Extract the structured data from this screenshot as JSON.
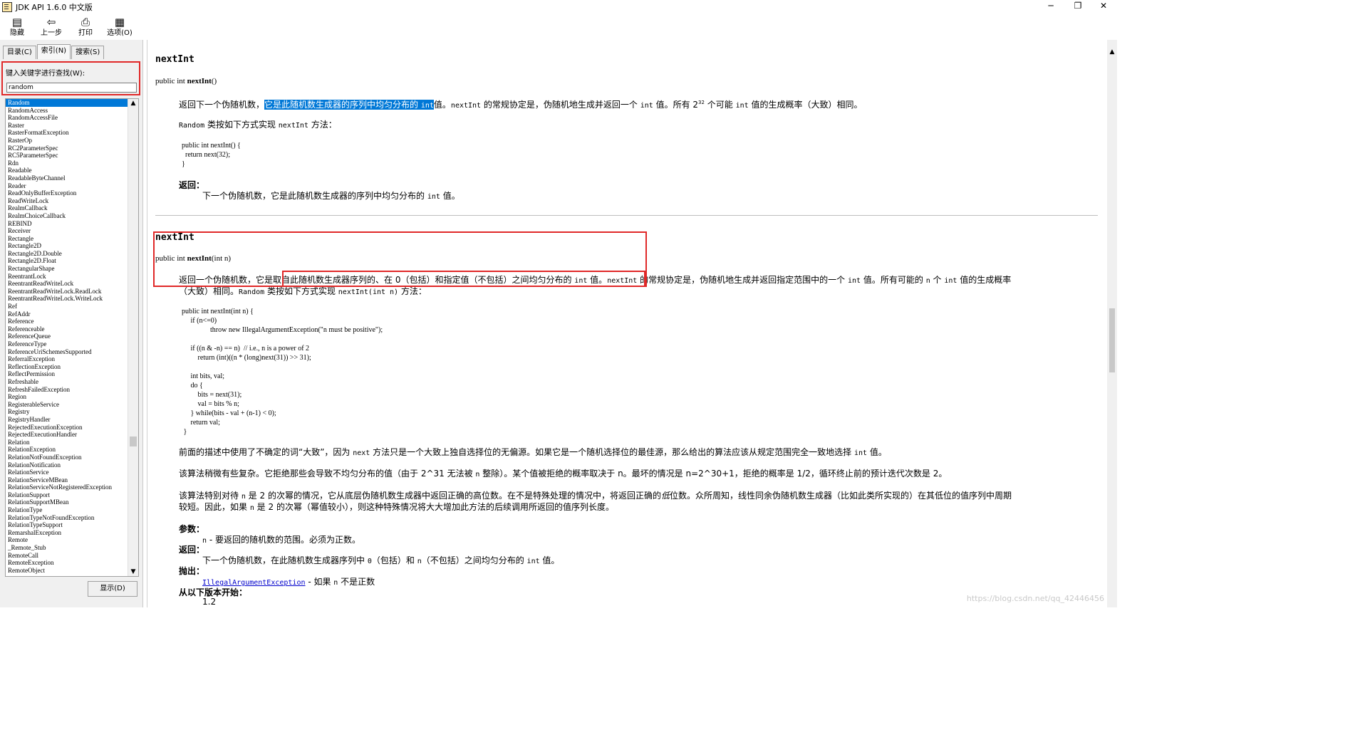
{
  "window": {
    "title": "JDK API 1.6.0 中文版",
    "controls": {
      "minimize": "─",
      "maximize": "❐",
      "close": "✕"
    }
  },
  "toolbar": {
    "hide": "隐藏",
    "back": "上一步",
    "print": "打印",
    "options": "选项(O)"
  },
  "left_pane": {
    "tabs": [
      "目录(C)",
      "索引(N)",
      "搜索(S)"
    ],
    "search_label": "键入关键字进行查找(W):",
    "search_value": "random",
    "items": [
      "Random",
      "RandomAccess",
      "RandomAccessFile",
      "Raster",
      "RasterFormatException",
      "RasterOp",
      "RC2ParameterSpec",
      "RC5ParameterSpec",
      "Rdn",
      "Readable",
      "ReadableByteChannel",
      "Reader",
      "ReadOnlyBufferException",
      "ReadWriteLock",
      "RealmCallback",
      "RealmChoiceCallback",
      "REBIND",
      "Receiver",
      "Rectangle",
      "Rectangle2D",
      "Rectangle2D.Double",
      "Rectangle2D.Float",
      "RectangularShape",
      "ReentrantLock",
      "ReentrantReadWriteLock",
      "ReentrantReadWriteLock.ReadLock",
      "ReentrantReadWriteLock.WriteLock",
      "Ref",
      "RefAddr",
      "Reference",
      "Referenceable",
      "ReferenceQueue",
      "ReferenceType",
      "ReferenceUriSchemesSupported",
      "ReferralException",
      "ReflectionException",
      "ReflectPermission",
      "Refreshable",
      "RefreshFailedException",
      "Region",
      "RegisterableService",
      "Registry",
      "RegistryHandler",
      "RejectedExecutionException",
      "RejectedExecutionHandler",
      "Relation",
      "RelationException",
      "RelationNotFoundException",
      "RelationNotification",
      "RelationService",
      "RelationServiceMBean",
      "RelationServiceNotRegisteredException",
      "RelationSupport",
      "RelationSupportMBean",
      "RelationType",
      "RelationTypeNotFoundException",
      "RelationTypeSupport",
      "RemarshalException",
      "Remote",
      "_Remote_Stub",
      "RemoteCall",
      "RemoteException",
      "RemoteObject"
    ],
    "selected": "Random",
    "display_button": "显示(D)"
  },
  "content": {
    "m1": {
      "name": "nextInt",
      "sig_pre": "public int ",
      "sig_name": "nextInt",
      "sig_post": "()",
      "p1_pre": "返回下一个伪随机数，",
      "p1_hl": "它是此随机数生成器的序列中均匀分布的 ",
      "p1_hl_code": "int",
      "p1_a": "值。",
      "p1_code1": "nextInt",
      "p1_b": " 的常规协定是，伪随机地生成并返回一个 ",
      "p1_code2": "int",
      "p1_c": " 值。所有 2",
      "p1_sup": "32",
      "p1_d": " 个可能 ",
      "p1_code3": "int",
      "p1_e": " 值的生成概率（大致）相同。",
      "p2_code1": "Random",
      "p2_a": " 类按如下方式实现 ",
      "p2_code2": "nextInt",
      "p2_b": " 方法：",
      "code": "public int nextInt() {\n  return next(32);\n}",
      "returns_label": "返回：",
      "returns_a": "下一个伪随机数，它是此随机数生成器的序列中均匀分布的 ",
      "returns_code": "int",
      "returns_b": " 值。"
    },
    "m2": {
      "name": "nextInt",
      "sig_pre": "public int ",
      "sig_name": "nextInt",
      "sig_post": "(int n)",
      "p1_a": "返回一个伪随机数，它是",
      "p1_box": "取自此随机数生成器序列的、在 0（包括）和指定值（不包括）之间均匀分布的 ",
      "p1_box_code": "int",
      "p1_box_b": " 值。",
      "p1_code1": "nextInt",
      "p1_b": " 的常规协定是，伪随机地生成并返回指定范围中的一个 ",
      "p1_code2": "int",
      "p1_c": " 值。所有可能的 ",
      "p1_code3": "n",
      "p1_d": " 个 ",
      "p1_code4": "int",
      "p1_e": " 值的生成概率",
      "p1_f": "（大致）相同。",
      "p1_code5": "Random",
      "p1_g": " 类按如下方式实现 ",
      "p1_code6": "nextInt(int n)",
      "p1_h": " 方法：",
      "code": "public int nextInt(int n) {\n     if (n<=0)\n                throw new IllegalArgumentException(\"n must be positive\");\n\n     if ((n & -n) == n)  // i.e., n is a power of 2\n         return (int)((n * (long)next(31)) >> 31);\n\n     int bits, val;\n     do {\n         bits = next(31);\n         val = bits % n;\n     } while(bits - val + (n-1) < 0);\n     return val;\n }",
      "p2_a": "前面的描述中使用了不确定的词“大致”，因为 ",
      "p2_code": "next",
      "p2_b": " 方法只是一个大致上独自选择位的无偏源。如果它是一个随机选择位的最佳源，那么给出的算法应该从规定范围完全一致地选择 ",
      "p2_code2": "int",
      "p2_c": " 值。",
      "p3_a": "该算法稍微有些复杂。它拒绝那些会导致不均匀分布的值（由于 2^31 无法被 ",
      "p3_code": "n",
      "p3_b": " 整除）。某个值被拒绝的概率取决于 n。最坏的情况是 n=2^30+1，拒绝的概率是 1/2，循环终止前的预计迭代次数是 2。",
      "p4_a": "该算法特别对待 ",
      "p4_code1": "n",
      "p4_b": " 是 2 的次幂的情况，它从底层伪随机数生成器中返回正确的高位数。在不是特殊处理的情况中，将返回正确的",
      "p4_italic": "低",
      "p4_c": "位数。众所周知，线性同余伪随机数生成器（比如此类所实现的）在其低位的值序列中周期",
      "p4_d": "较短。因此，如果 ",
      "p4_code2": "n",
      "p4_e": " 是 2 的次幂（幂值较小），则这种特殊情况将大大增加此方法的后续调用所返回的值序列长度。",
      "params_label": "参数：",
      "params_code": "n",
      "params_text": " - 要返回的随机数的范围。必须为正数。",
      "returns_label": "返回：",
      "returns_a": "下一个伪随机数，在此随机数生成器序列中 ",
      "returns_code1": "0",
      "returns_b": "（包括）和 ",
      "returns_code2": "n",
      "returns_c": "（不包括）之间均匀分布的 ",
      "returns_code3": "int",
      "returns_d": " 值。",
      "throws_label": "抛出：",
      "throws_link": "IllegalArgumentException",
      "throws_a": " - 如果 ",
      "throws_code": "n",
      "throws_b": " 不是正数",
      "since_label": "从以下版本开始：",
      "since_value": "1.2"
    }
  },
  "watermark": "https://blog.csdn.net/qq_42446456"
}
